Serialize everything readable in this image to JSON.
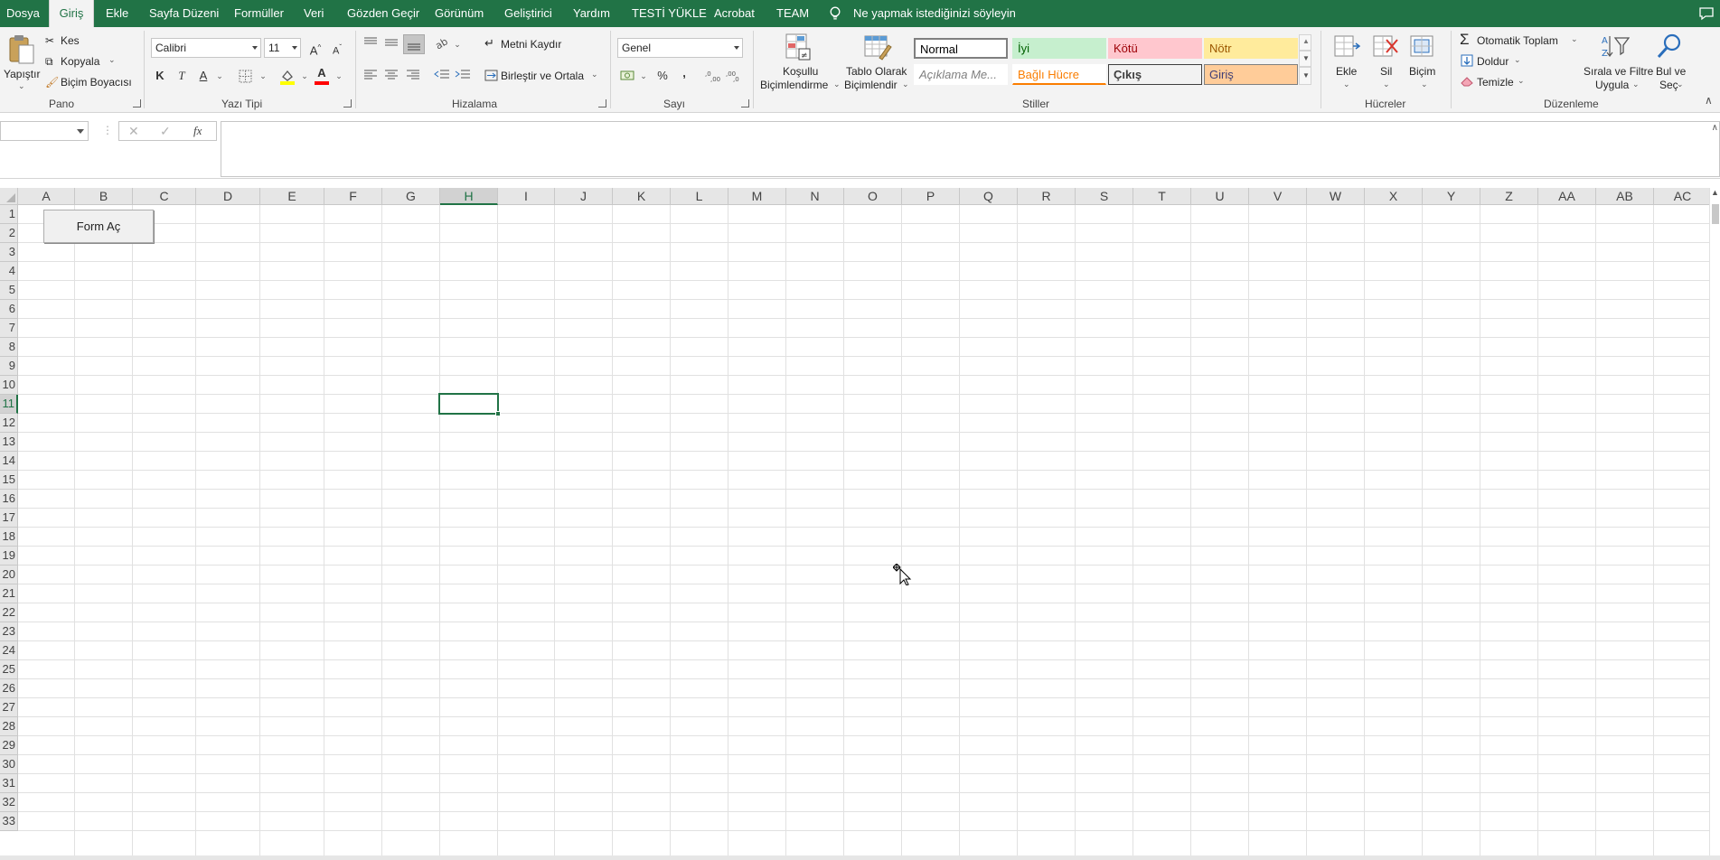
{
  "menu": {
    "tabs": [
      "Dosya",
      "Giriş",
      "Ekle",
      "Sayfa Düzeni",
      "Formüller",
      "Veri",
      "Gözden Geçir",
      "Görünüm",
      "Geliştirici",
      "Yardım",
      "TESTİ YÜKLE",
      "Acrobat",
      "TEAM"
    ],
    "active_tab": "Giriş",
    "tell_me": "Ne yapmak istediğinizi söyleyin"
  },
  "ribbon": {
    "clipboard": {
      "paste": "Yapıştır",
      "cut": "Kes",
      "copy": "Kopyala",
      "format_painter": "Biçim Boyacısı",
      "group": "Pano"
    },
    "font": {
      "name": "Calibri",
      "size": "11",
      "bold": "K",
      "italic": "T",
      "underline": "A",
      "font_color": "A",
      "group": "Yazı Tipi"
    },
    "alignment": {
      "wrap_text": "Metni Kaydır",
      "merge_center": "Birleştir ve Ortala",
      "group": "Hizalama"
    },
    "number": {
      "format": "Genel",
      "percent": "%",
      "comma": ",",
      "group": "Sayı"
    },
    "styles": {
      "conditional_formatting": [
        "Koşullu",
        "Biçimlendirme"
      ],
      "format_as_table": [
        "Tablo Olarak",
        "Biçimlendir"
      ],
      "cells": [
        {
          "label": "Normal",
          "bg": "#ffffff",
          "color": "#000000",
          "border": "#7f7f7f"
        },
        {
          "label": "İyi",
          "bg": "#c6efce",
          "color": "#006100",
          "border": "#c6efce"
        },
        {
          "label": "Kötü",
          "bg": "#ffc7ce",
          "color": "#9c0006",
          "border": "#ffc7ce"
        },
        {
          "label": "Nötr",
          "bg": "#ffeb9c",
          "color": "#9c5700",
          "border": "#ffeb9c"
        },
        {
          "label": "Açıklama Me...",
          "bg": "#ffffff",
          "color": "#7f7f7f",
          "border": "#ffffff"
        },
        {
          "label": "Bağlı Hücre",
          "bg": "#ffffff",
          "color": "#fa7d00",
          "border": "#ffffff"
        },
        {
          "label": "Çıkış",
          "bg": "#f2f2f2",
          "color": "#3f3f3f",
          "border": "#3f3f3f"
        },
        {
          "label": "Giriş",
          "bg": "#ffcc99",
          "color": "#3f3f76",
          "border": "#7f7f7f"
        }
      ],
      "group": "Stiller"
    },
    "cells_group": {
      "insert": "Ekle",
      "delete": "Sil",
      "format": "Biçim",
      "group": "Hücreler"
    },
    "editing": {
      "autosum": "Otomatik Toplam",
      "fill": "Doldur",
      "clear": "Temizle",
      "sort_filter": [
        "Sırala ve Filtre",
        "Uygula"
      ],
      "find_select": [
        "Bul ve",
        "Seç"
      ],
      "group": "Düzenleme"
    }
  },
  "formula_bar": {
    "name_box": "",
    "formula": "",
    "fx": "fx"
  },
  "sheet": {
    "columns": [
      "A",
      "B",
      "C",
      "D",
      "E",
      "F",
      "G",
      "H",
      "I",
      "J",
      "K",
      "L",
      "M",
      "N",
      "O",
      "P",
      "Q",
      "R",
      "S",
      "T",
      "U",
      "V",
      "W",
      "X",
      "Y",
      "Z",
      "AA",
      "AB",
      "AC"
    ],
    "rows": [
      1,
      2,
      3,
      4,
      5,
      6,
      7,
      8,
      9,
      10,
      11,
      12,
      13,
      14,
      15,
      16,
      17,
      18,
      19,
      20,
      21,
      22,
      23,
      24,
      25,
      26,
      27,
      28,
      29,
      30,
      31,
      32,
      33
    ],
    "selected_column": "H",
    "selected_row": 11,
    "button_label": "Form Aç"
  },
  "colors": {
    "accent": "#217346",
    "ribbon_bg": "#f3f3f3"
  }
}
